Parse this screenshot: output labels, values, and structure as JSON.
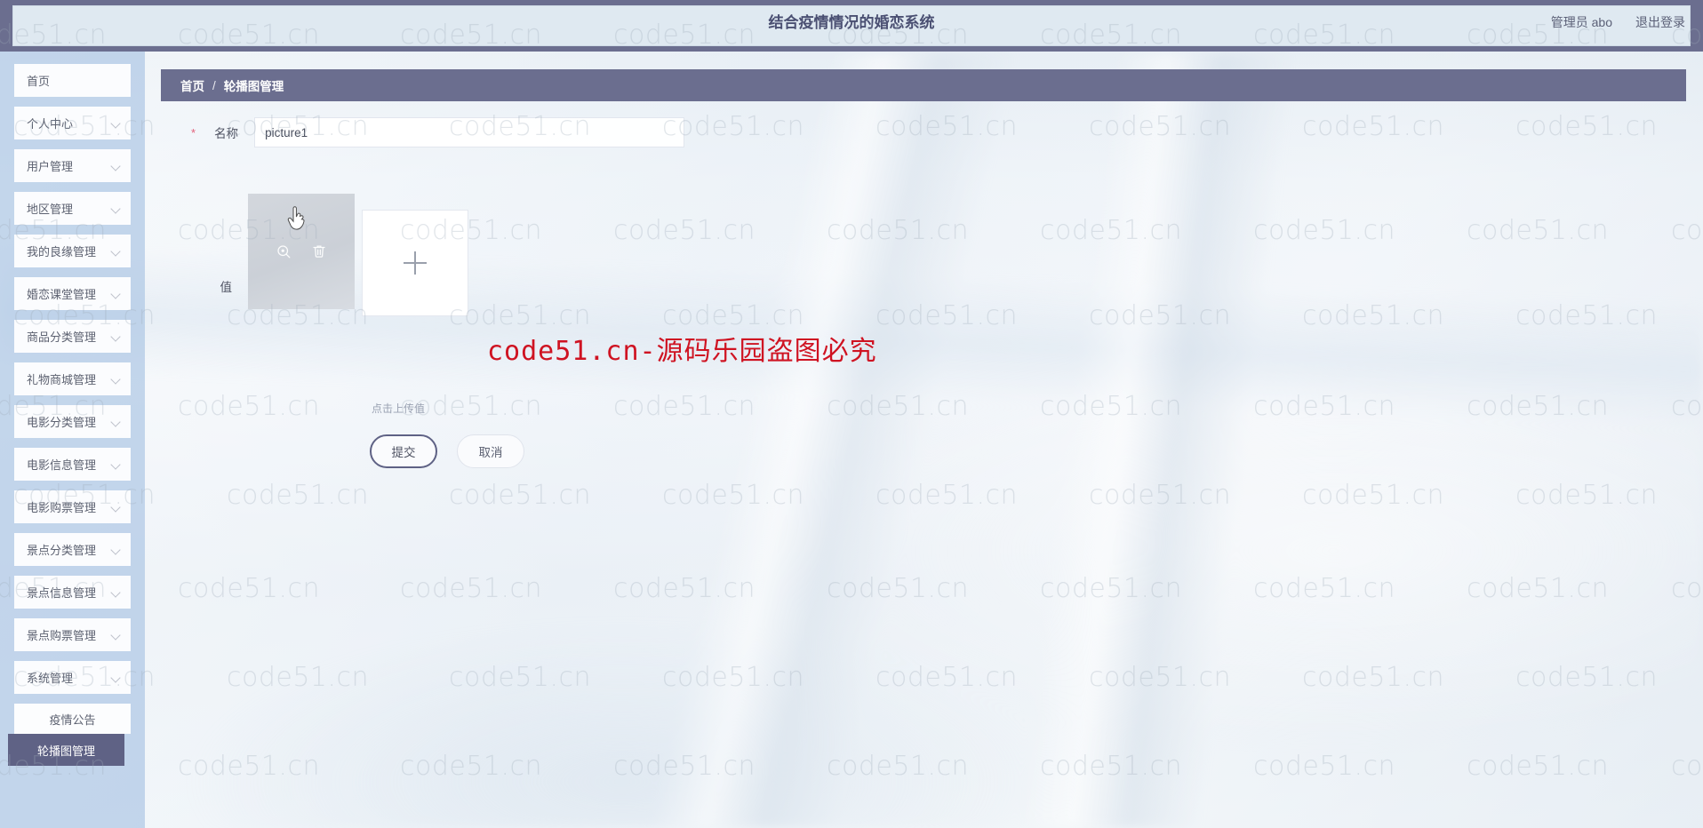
{
  "header": {
    "title": "结合疫情情况的婚恋系统",
    "admin_label": "管理员 abo",
    "logout_label": "退出登录"
  },
  "sidebar": {
    "items": [
      {
        "label": "首页",
        "expandable": false
      },
      {
        "label": "个人中心",
        "expandable": true
      },
      {
        "label": "用户管理",
        "expandable": true
      },
      {
        "label": "地区管理",
        "expandable": true
      },
      {
        "label": "我的良缘管理",
        "expandable": true
      },
      {
        "label": "婚恋课堂管理",
        "expandable": true
      },
      {
        "label": "商品分类管理",
        "expandable": true
      },
      {
        "label": "礼物商城管理",
        "expandable": true
      },
      {
        "label": "电影分类管理",
        "expandable": true
      },
      {
        "label": "电影信息管理",
        "expandable": true
      },
      {
        "label": "电影购票管理",
        "expandable": true
      },
      {
        "label": "景点分类管理",
        "expandable": true
      },
      {
        "label": "景点信息管理",
        "expandable": true
      },
      {
        "label": "景点购票管理",
        "expandable": true
      },
      {
        "label": "系统管理",
        "expandable": true
      }
    ],
    "submenu": [
      {
        "label": "疫情公告",
        "active": false
      },
      {
        "label": "轮播图管理",
        "active": true
      }
    ]
  },
  "breadcrumb": {
    "home": "首页",
    "separator": "/",
    "current": "轮播图管理"
  },
  "form": {
    "name_required_mark": "*",
    "name_label": "名称",
    "name_value": "picture1",
    "name_placeholder": "名称",
    "value_label": "值",
    "upload_hint": "点击上传值",
    "preview_icon": "zoom-in-icon",
    "delete_icon": "trash-icon",
    "add_icon": "plus-icon",
    "submit_label": "提交",
    "cancel_label": "取消"
  },
  "watermarks": {
    "tile_text": "code51.cn",
    "red_text": "code51.cn-源码乐园盗图必究",
    "red_color": "#cf1322"
  },
  "colors": {
    "topbar": "#6b6e8f",
    "sidebar": "#afc7e4",
    "active_menu": "#5f6285",
    "required_star": "#e2607a"
  }
}
